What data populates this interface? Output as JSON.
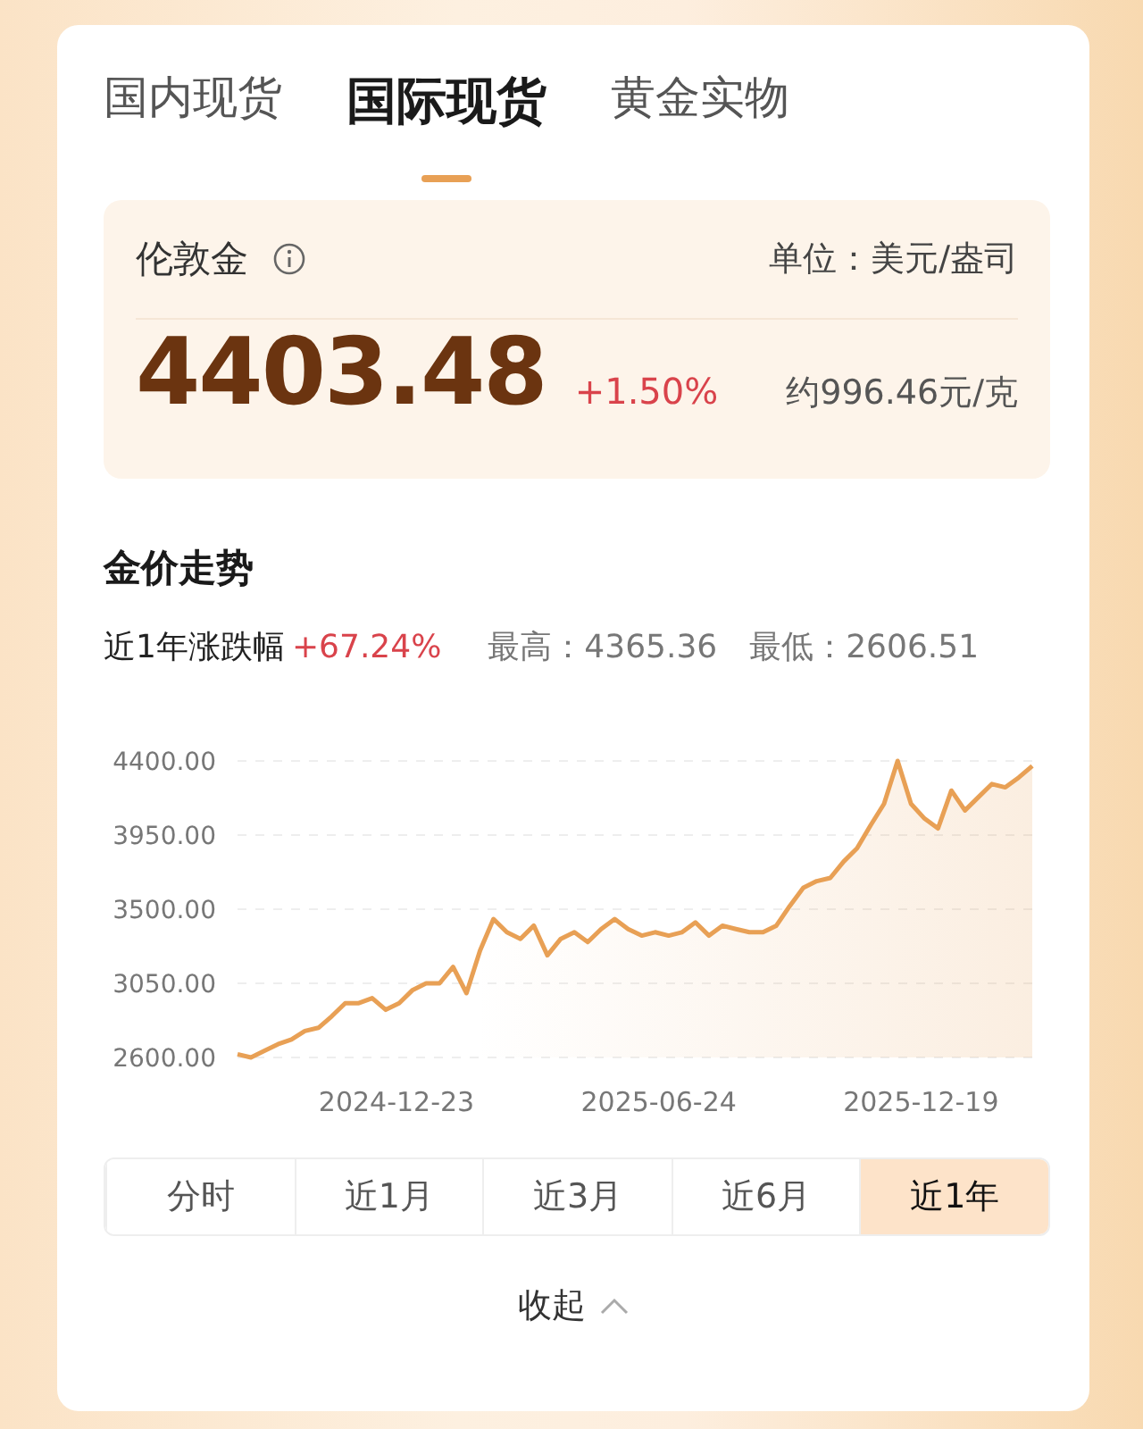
{
  "tabs": [
    {
      "label": "国内现货",
      "selected": false
    },
    {
      "label": "国际现货",
      "selected": true
    },
    {
      "label": "黄金实物",
      "selected": false
    }
  ],
  "quote": {
    "name": "伦敦金",
    "unit": "单位：美元/盎司",
    "price": "4403.48",
    "change": "+1.50%",
    "per_gram": "约996.46元/克"
  },
  "trend": {
    "title": "金价走势",
    "period_label": "近1年涨跌幅",
    "period_change": "+67.24%",
    "high": "最高：4365.36",
    "low": "最低：2606.51",
    "dates": [
      "2024-12-23",
      "2025-06-24",
      "2025-12-19"
    ],
    "chart_data": {
      "type": "line",
      "grid": true,
      "ylim": [
        2600,
        4400
      ],
      "yticks": [
        {
          "value": 2600,
          "label": "2600.00"
        },
        {
          "value": 3050,
          "label": "3050.00"
        },
        {
          "value": 3500,
          "label": "3500.00"
        },
        {
          "value": 3950,
          "label": "3950.00"
        },
        {
          "value": 4400,
          "label": "4400.00"
        }
      ],
      "series": [
        {
          "color": "#e8a055",
          "values": [
            2620,
            2600,
            2640,
            2680,
            2710,
            2760,
            2780,
            2850,
            2930,
            2930,
            2960,
            2890,
            2930,
            3010,
            3050,
            3050,
            3150,
            2990,
            3250,
            3440,
            3360,
            3320,
            3400,
            3220,
            3320,
            3360,
            3300,
            3380,
            3440,
            3380,
            3340,
            3360,
            3340,
            3360,
            3420,
            3340,
            3400,
            3380,
            3360,
            3360,
            3400,
            3520,
            3630,
            3670,
            3690,
            3790,
            3870,
            4010,
            4140,
            4400,
            4140,
            4050,
            3990,
            4220,
            4100,
            4180,
            4260,
            4240,
            4300,
            4370
          ]
        }
      ]
    }
  },
  "ranges": [
    {
      "label": "分时",
      "selected": false
    },
    {
      "label": "近1月",
      "selected": false
    },
    {
      "label": "近3月",
      "selected": false
    },
    {
      "label": "近6月",
      "selected": false
    },
    {
      "label": "近1年",
      "selected": true
    }
  ],
  "collapse": {
    "label": "收起"
  }
}
